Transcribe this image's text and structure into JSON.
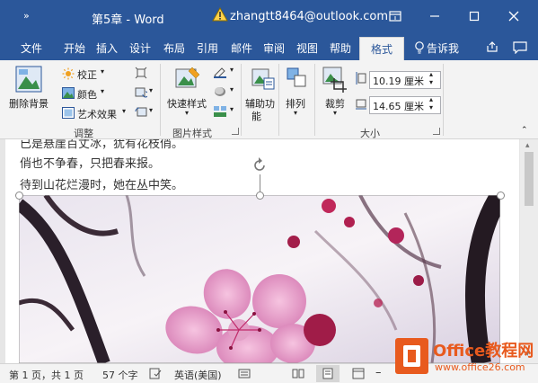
{
  "titlebar": {
    "qa_symbol": "»",
    "doc_title": "第5章 - Word",
    "account": "zhangtt8464@outlook.com",
    "bg_color": "#2b579a"
  },
  "tabs": [
    {
      "label": "文件"
    },
    {
      "label": "开始"
    },
    {
      "label": "插入"
    },
    {
      "label": "设计"
    },
    {
      "label": "布局"
    },
    {
      "label": "引用"
    },
    {
      "label": "邮件"
    },
    {
      "label": "审阅"
    },
    {
      "label": "视图"
    },
    {
      "label": "帮助"
    },
    {
      "label": "格式"
    },
    {
      "label": "告诉我"
    }
  ],
  "ribbon": {
    "remove_bg": "删除背景",
    "correct": "校正",
    "color": "颜色",
    "artistic": "艺术效果",
    "adjust_group": "调整",
    "quick_styles": "快速样式",
    "styles_group": "图片样式",
    "assist_line1": "辅助功",
    "assist_line2": "能",
    "arrange": "排列",
    "crop": "裁剪",
    "height": "10.19 厘米",
    "width": "14.65 厘米",
    "size_group": "大小"
  },
  "document": {
    "line1": "已是悬崖百丈冰，犹有花枝俏。",
    "line2": "俏也不争春，只把春来报。",
    "line3": "待到山花烂漫时，她在丛中笑。"
  },
  "statusbar": {
    "page": "第 1 页，共 1 页",
    "words": "57 个字",
    "language": "英语(美国)"
  },
  "watermark": {
    "brand": "Office教程网",
    "url": "www.office26.com"
  }
}
